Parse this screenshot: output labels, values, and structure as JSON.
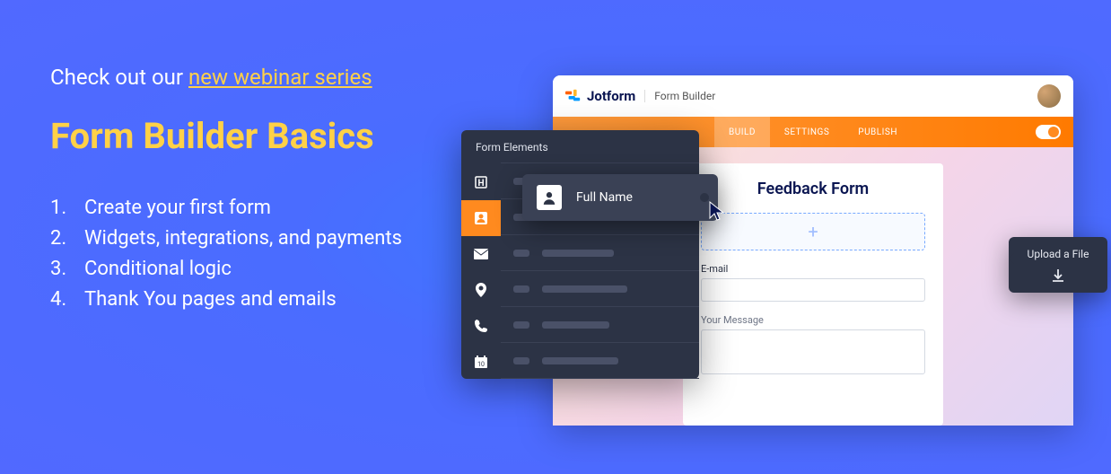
{
  "promo": {
    "check_prefix": "Check out our ",
    "check_link": "new webinar series",
    "title": "Form Builder Basics",
    "bullets": [
      "Create your first form",
      "Widgets, integrations, and payments",
      "Conditional logic",
      "Thank You pages and emails"
    ]
  },
  "app": {
    "brand": "Jotform",
    "header_label": "Form Builder",
    "tabs": {
      "build": "BUILD",
      "settings": "SETTINGS",
      "publish": "PUBLISH"
    },
    "form": {
      "title": "Feedback Form",
      "email_label": "E-mail",
      "message_label": "Your Message",
      "drop_icon": "+"
    }
  },
  "elements_panel": {
    "header": "Form Elements",
    "floating_label": "Full Name",
    "rail_icons": [
      "heading-icon",
      "person-icon",
      "envelope-icon",
      "pin-icon",
      "phone-icon",
      "calendar-icon"
    ]
  },
  "upload": {
    "label": "Upload a File"
  }
}
